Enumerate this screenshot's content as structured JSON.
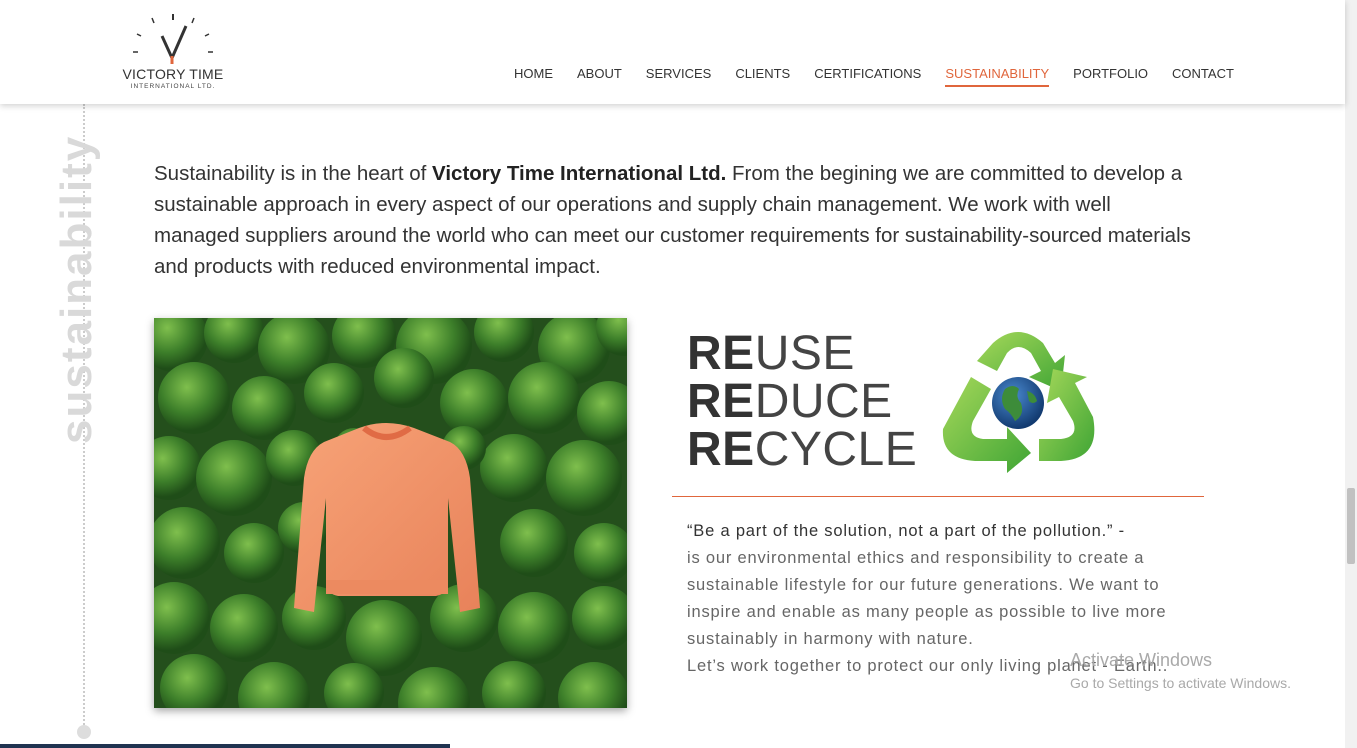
{
  "logo": {
    "title": "VICTORY TIME",
    "subtitle": "INTERNATIONAL LTD."
  },
  "nav": {
    "items": [
      "HOME",
      "ABOUT",
      "SERVICES",
      "CLIENTS",
      "CERTIFICATIONS",
      "SUSTAINABILITY",
      "PORTFOLIO",
      "CONTACT"
    ],
    "active": "SUSTAINABILITY"
  },
  "side_label": "sustainability",
  "intro": {
    "before": "Sustainability is in the heart of ",
    "company": "Victory Time International Ltd.",
    "after": " From the begining we are committed to develop a sustainable approach in every aspect of our operations and supply chain management. We work with well managed suppliers around the world who can meet our customer requirements for sustainability-sourced materials and products with reduced environmental impact."
  },
  "rrr": [
    {
      "prefix": "RE",
      "rest": "USE"
    },
    {
      "prefix": "RE",
      "rest": "DUCE"
    },
    {
      "prefix": "RE",
      "rest": "CYCLE"
    }
  ],
  "quote": {
    "headline": "“Be a part of the solution, not a part of the pollution.” -",
    "body": "is our environmental ethics and responsibility to create a sustainable lifestyle for our future generations. We want to inspire and enable as many people as possible to live more sustainably in harmony with nature.",
    "closing": "Let’s work together to protect our only living planet - Earth.."
  },
  "watermark": {
    "line1": "Activate Windows",
    "line2": "Go to Settings to activate Windows."
  },
  "colors": {
    "accent": "#e0663c",
    "text": "#333333",
    "side_label": "#d9d9d9"
  },
  "icons": [
    "clock-logo-icon",
    "recycle-globe-icon"
  ]
}
